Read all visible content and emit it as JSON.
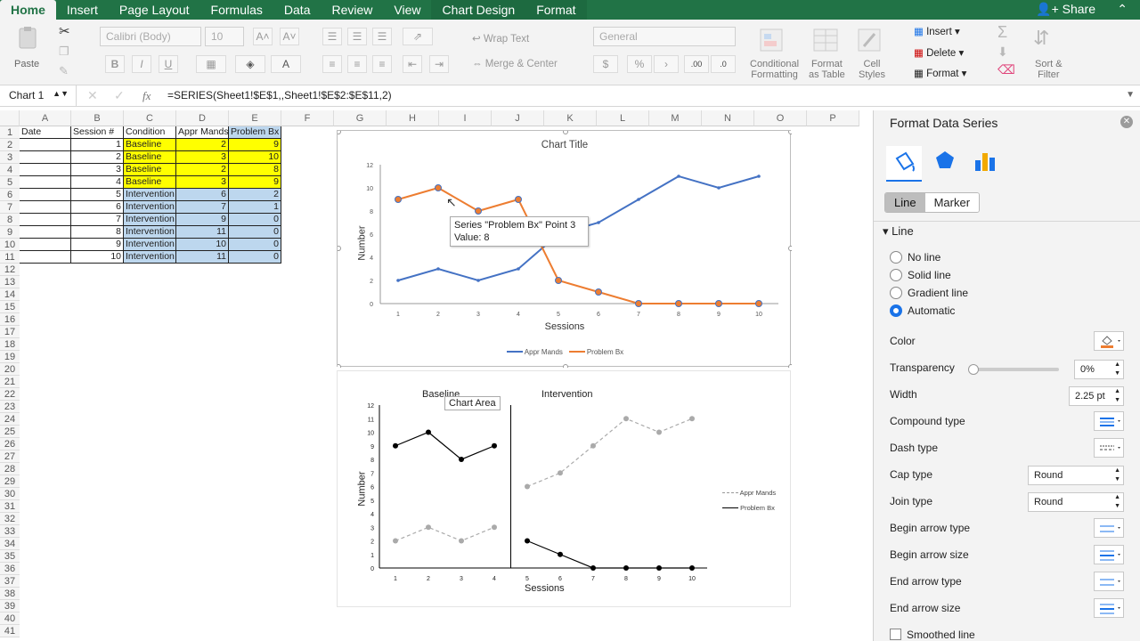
{
  "ribbon_tabs": [
    "Home",
    "Insert",
    "Page Layout",
    "Formulas",
    "Data",
    "Review",
    "View",
    "Chart Design",
    "Format"
  ],
  "share_label": "Share",
  "ribbon": {
    "paste": "Paste",
    "font_name": "Calibri (Body)",
    "font_size": "10",
    "wrap_text": "Wrap Text",
    "merge_center": "Merge & Center",
    "number_format": "General",
    "conditional_formatting": [
      "Conditional",
      "Formatting"
    ],
    "format_as_table": [
      "Format",
      "as Table"
    ],
    "cell_styles": [
      "Cell",
      "Styles"
    ],
    "insert": "Insert",
    "delete": "Delete",
    "format": "Format",
    "sort_filter": [
      "Sort &",
      "Filter"
    ]
  },
  "formula_bar": {
    "name_box": "Chart 1",
    "fx": "fx",
    "formula": "=SERIES(Sheet1!$E$1,,Sheet1!$E$2:$E$11,2)"
  },
  "columns": [
    "A",
    "B",
    "C",
    "D",
    "E",
    "F",
    "G",
    "H",
    "I",
    "J",
    "K",
    "L",
    "M",
    "N",
    "O",
    "P"
  ],
  "table": {
    "headers": [
      "Date",
      "Session #",
      "Condition",
      "Appr Mands",
      "Problem Bx"
    ],
    "rows": [
      [
        "",
        "1",
        "Baseline",
        "2",
        "9"
      ],
      [
        "",
        "2",
        "Baseline",
        "3",
        "10"
      ],
      [
        "",
        "3",
        "Baseline",
        "2",
        "8"
      ],
      [
        "",
        "4",
        "Baseline",
        "3",
        "9"
      ],
      [
        "",
        "5",
        "Intervention",
        "6",
        "2"
      ],
      [
        "",
        "6",
        "Intervention",
        "7",
        "1"
      ],
      [
        "",
        "7",
        "Intervention",
        "9",
        "0"
      ],
      [
        "",
        "8",
        "Intervention",
        "11",
        "0"
      ],
      [
        "",
        "9",
        "Intervention",
        "10",
        "0"
      ],
      [
        "",
        "10",
        "Intervention",
        "11",
        "0"
      ]
    ]
  },
  "chart1": {
    "title": "Chart Title",
    "ylabel": "Number",
    "xlabel": "Sessions",
    "legend": [
      "Appr Mands",
      "Problem Bx"
    ],
    "tooltip_line1": "Series \"Problem Bx\" Point 3",
    "tooltip_line2": "Value: 8"
  },
  "chart2": {
    "baseline_label": "Baseline",
    "intervention_label": "Intervention",
    "chart_area_tip": "Chart Area",
    "ylabel": "Number",
    "xlabel": "Sessions",
    "legend": [
      "Appr Mands",
      "Problem Bx"
    ]
  },
  "chart_data": [
    {
      "type": "line",
      "title": "Chart Title",
      "xlabel": "Sessions",
      "ylabel": "Number",
      "x": [
        1,
        2,
        3,
        4,
        5,
        6,
        7,
        8,
        9,
        10
      ],
      "ylim": [
        0,
        12
      ],
      "series": [
        {
          "name": "Appr Mands",
          "color": "#4472c4",
          "values": [
            2,
            3,
            2,
            3,
            6,
            7,
            9,
            11,
            10,
            11
          ]
        },
        {
          "name": "Problem Bx",
          "color": "#ed7d31",
          "values": [
            9,
            10,
            8,
            9,
            2,
            1,
            0,
            0,
            0,
            0
          ]
        }
      ],
      "legend_position": "bottom"
    },
    {
      "type": "line",
      "xlabel": "Sessions",
      "ylabel": "Number",
      "x": [
        1,
        2,
        3,
        4,
        5,
        6,
        7,
        8,
        9,
        10
      ],
      "ylim": [
        0,
        12
      ],
      "phases": [
        "Baseline",
        "Intervention"
      ],
      "series": [
        {
          "name": "Appr Mands",
          "color": "#aaaaaa",
          "values": [
            2,
            3,
            2,
            3,
            6,
            7,
            9,
            11,
            10,
            11
          ]
        },
        {
          "name": "Problem Bx",
          "color": "#000000",
          "values": [
            9,
            10,
            8,
            9,
            2,
            1,
            0,
            0,
            0,
            0
          ]
        }
      ],
      "legend_position": "right"
    }
  ],
  "format_panel": {
    "title": "Format Data Series",
    "tab_line": "Line",
    "tab_marker": "Marker",
    "section": "Line",
    "options": [
      "No line",
      "Solid line",
      "Gradient line",
      "Automatic"
    ],
    "color_label": "Color",
    "transparency_label": "Transparency",
    "transparency_value": "0%",
    "width_label": "Width",
    "width_value": "2.25 pt",
    "compound_label": "Compound type",
    "dash_label": "Dash type",
    "cap_label": "Cap type",
    "cap_value": "Round",
    "join_label": "Join type",
    "join_value": "Round",
    "begin_arrow_type": "Begin arrow type",
    "begin_arrow_size": "Begin arrow size",
    "end_arrow_type": "End arrow type",
    "end_arrow_size": "End arrow size",
    "smoothed": "Smoothed line",
    "accent_color": "#ed7d31"
  }
}
